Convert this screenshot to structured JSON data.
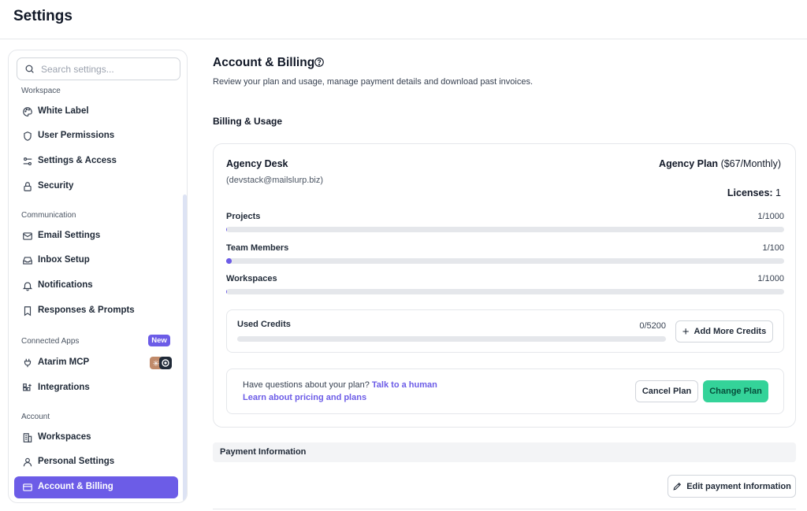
{
  "header": {
    "title": "Settings"
  },
  "sidebar": {
    "search_placeholder": "Search settings...",
    "sections": {
      "workspace": "Workspace",
      "communication": "Communication",
      "connected_apps": "Connected Apps",
      "account": "Account"
    },
    "new_badge": "New",
    "items": {
      "white_label": "White Label",
      "user_permissions": "User Permissions",
      "settings_access": "Settings & Access",
      "security": "Security",
      "email_settings": "Email Settings",
      "inbox_setup": "Inbox Setup",
      "notifications": "Notifications",
      "responses_prompts": "Responses & Prompts",
      "atarim_mcp": "Atarim MCP",
      "integrations": "Integrations",
      "workspaces": "Workspaces",
      "personal_settings": "Personal Settings",
      "account_billing": "Account & Billing"
    },
    "active_item": "account_billing",
    "accent_color": "#6c5ce7"
  },
  "main": {
    "title": "Account & Billing",
    "subtitle": "Review your plan and usage, manage payment details and download past invoices.",
    "billing_heading": "Billing & Usage",
    "account": {
      "name": "Agency Desk",
      "email": "(devstack@mailslurp.biz)",
      "plan_name": "Agency Plan",
      "plan_price": "($67/Monthly)",
      "licenses_label": "Licenses:",
      "licenses_value": "1"
    },
    "usage": [
      {
        "label": "Projects",
        "value": "1/1000",
        "fraction": 0.001
      },
      {
        "label": "Team Members",
        "value": "1/100",
        "fraction": 0.01
      },
      {
        "label": "Workspaces",
        "value": "1/1000",
        "fraction": 0.001
      }
    ],
    "credits": {
      "label": "Used Credits",
      "value": "0/5200",
      "fraction": 0,
      "add_button": "Add More Credits"
    },
    "help": {
      "question": "Have questions about your plan?",
      "talk_link": "Talk to a human",
      "pricing_link": "Learn about pricing and plans",
      "cancel_button": "Cancel Plan",
      "change_button": "Change Plan"
    },
    "payment": {
      "heading": "Payment Information",
      "edit_button": "Edit payment Information"
    }
  }
}
